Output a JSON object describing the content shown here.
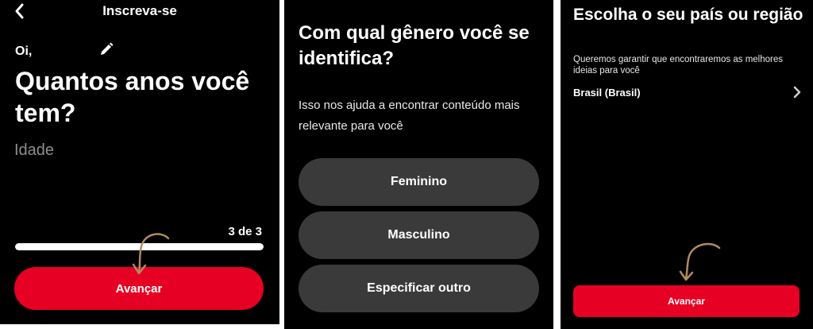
{
  "screen1": {
    "header_title": "Inscreva-se",
    "greeting": "Oi,",
    "question": "Quantos anos você tem?",
    "age_placeholder": "Idade",
    "step_label": "3 de 3",
    "progress_fraction": 1.0,
    "next_label": "Avançar"
  },
  "screen2": {
    "title": "Com qual gênero você se identifica?",
    "subtitle": "Isso nos ajuda a encontrar conteúdo mais relevante para você",
    "options": [
      {
        "label": "Feminino"
      },
      {
        "label": "Masculino"
      },
      {
        "label": "Especificar outro"
      }
    ]
  },
  "screen3": {
    "title": "Escolha o seu país ou região",
    "subtitle": "Queremos garantir que encontraremos as melhores ideias para você",
    "country_value": "Brasil (Brasil)",
    "next_label": "Avançar"
  },
  "colors": {
    "brand_red": "#e60023",
    "screen_bg": "#000000",
    "option_bg": "#3a3a3a",
    "annotation_arrow": "#b08a5e"
  },
  "icons": {
    "back": "chevron-left-icon",
    "edit": "pencil-icon",
    "country_chevron": "chevron-right-icon",
    "annotation": "curved-arrow-icon"
  }
}
